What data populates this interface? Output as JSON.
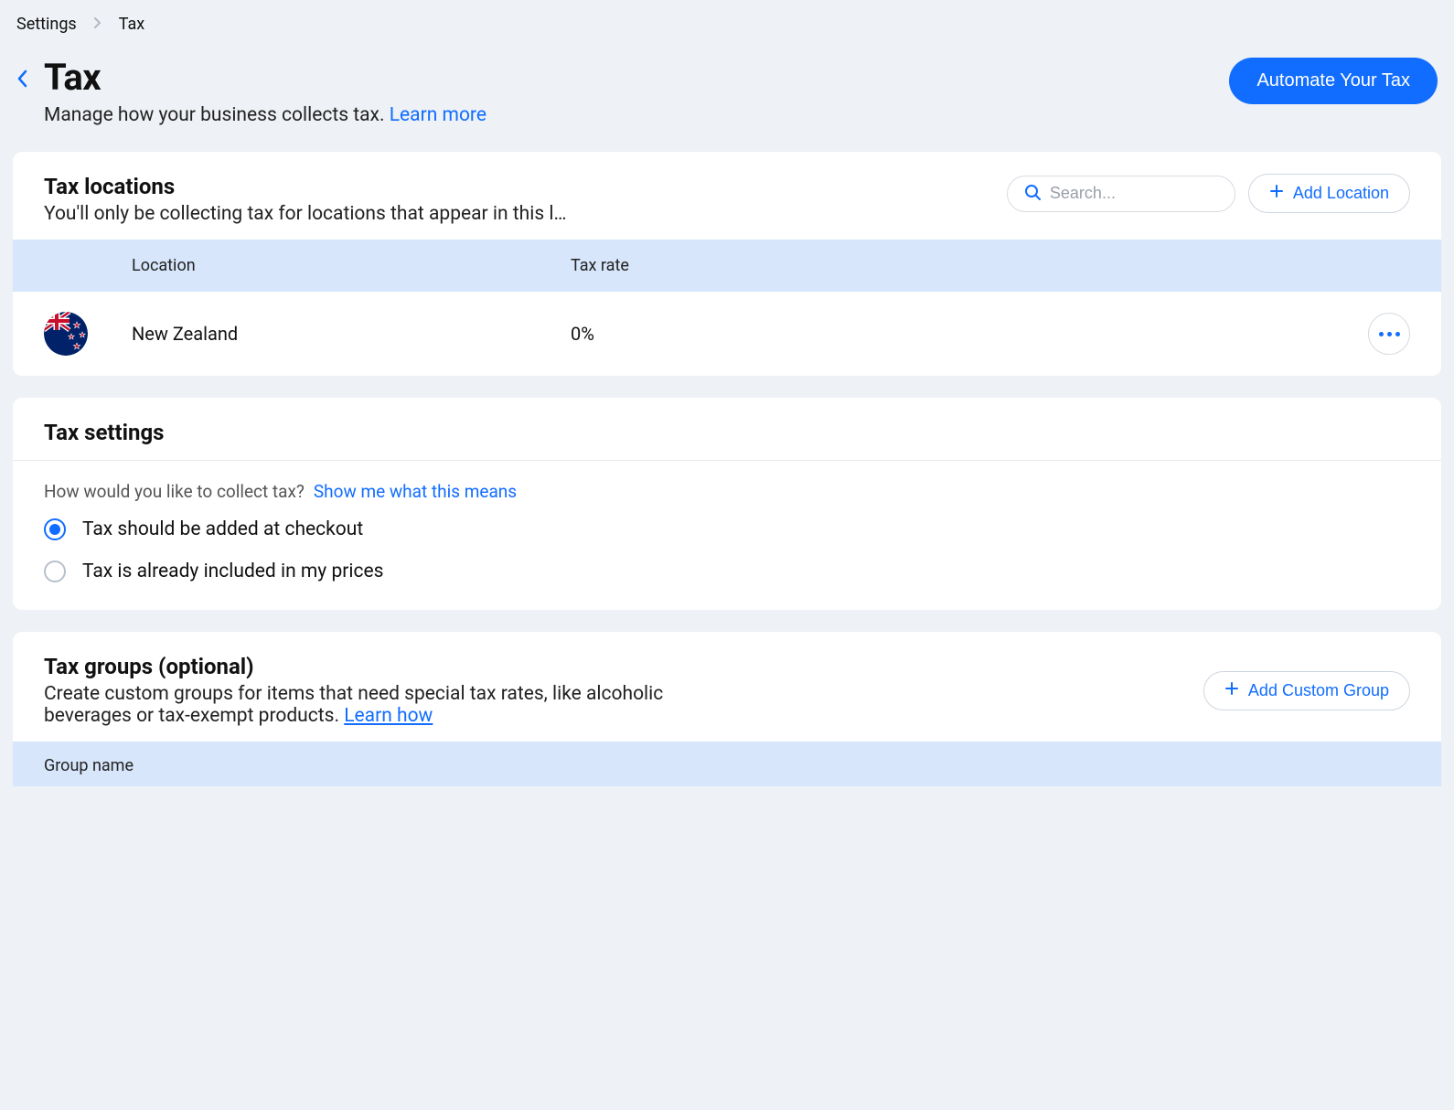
{
  "breadcrumb": {
    "items": [
      "Settings",
      "Tax"
    ]
  },
  "header": {
    "title": "Tax",
    "subtitle": "Manage how your business collects tax.",
    "learn_more": "Learn more",
    "automate_button": "Automate Your Tax"
  },
  "locations_card": {
    "title": "Tax locations",
    "description": "You'll only be collecting tax for locations that appear in this l…",
    "search_placeholder": "Search...",
    "add_button": "Add Location",
    "columns": {
      "location": "Location",
      "rate": "Tax rate"
    },
    "rows": [
      {
        "flag": "nz",
        "name": "New Zealand",
        "rate": "0%"
      }
    ]
  },
  "settings_card": {
    "title": "Tax settings",
    "question": "How would you like to collect tax?",
    "help_link": "Show me what this means",
    "options": [
      {
        "label": "Tax should be added at checkout",
        "selected": true
      },
      {
        "label": "Tax is already included in my prices",
        "selected": false
      }
    ]
  },
  "groups_card": {
    "title": "Tax groups (optional)",
    "description": "Create custom groups for items that need special tax rates, like alcoholic beverages or tax-exempt products.",
    "learn_how": "Learn how",
    "add_button": "Add Custom Group",
    "columns": {
      "name": "Group name"
    }
  }
}
